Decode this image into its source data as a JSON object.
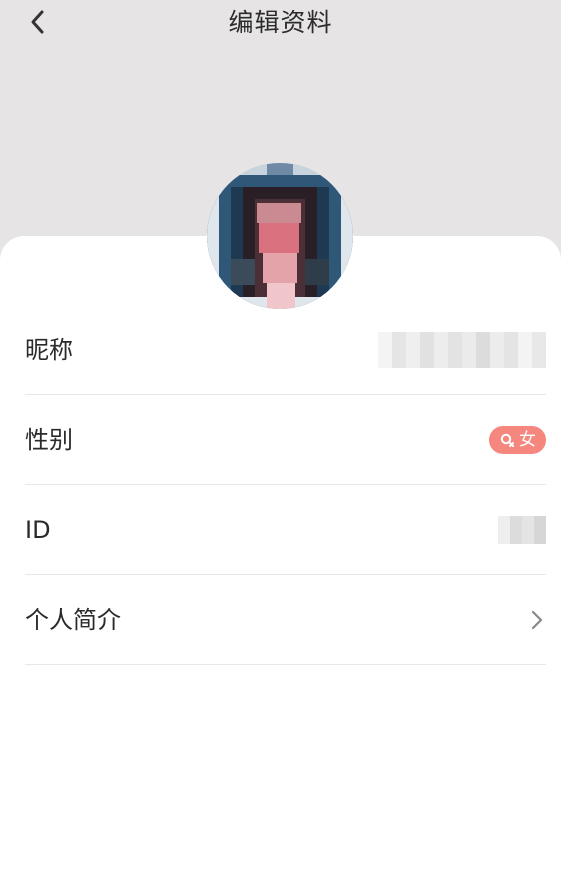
{
  "header": {
    "title": "编辑资料",
    "back_icon": "chevron-left-icon"
  },
  "avatar": {
    "description_icon": "avatar"
  },
  "rows": [
    {
      "label": "昵称",
      "value_type": "blurred-text"
    },
    {
      "label": "性别",
      "value_type": "badge",
      "badge": "女"
    },
    {
      "label": "ID",
      "value_type": "blurred-text"
    },
    {
      "label": "个人简介",
      "value_type": "chevron"
    }
  ],
  "colors": {
    "header_bg": "#e6e4e5",
    "badge_bg": "#f5877e",
    "divider": "#e8e8e8"
  }
}
